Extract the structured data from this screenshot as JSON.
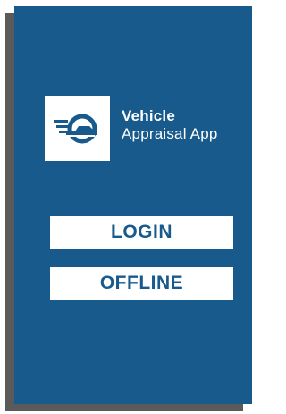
{
  "app": {
    "name_line1": "Vehicle",
    "name_line2": "Appraisal App",
    "logo_icon": "speeding-car-icon"
  },
  "actions": {
    "login_label": "LOGIN",
    "offline_label": "OFFLINE"
  },
  "colors": {
    "screen_background": "#185a8c",
    "shadow": "#5a5a5a",
    "button_background": "#ffffff",
    "button_text": "#185a8c",
    "logo_icon": "#185a8c"
  }
}
